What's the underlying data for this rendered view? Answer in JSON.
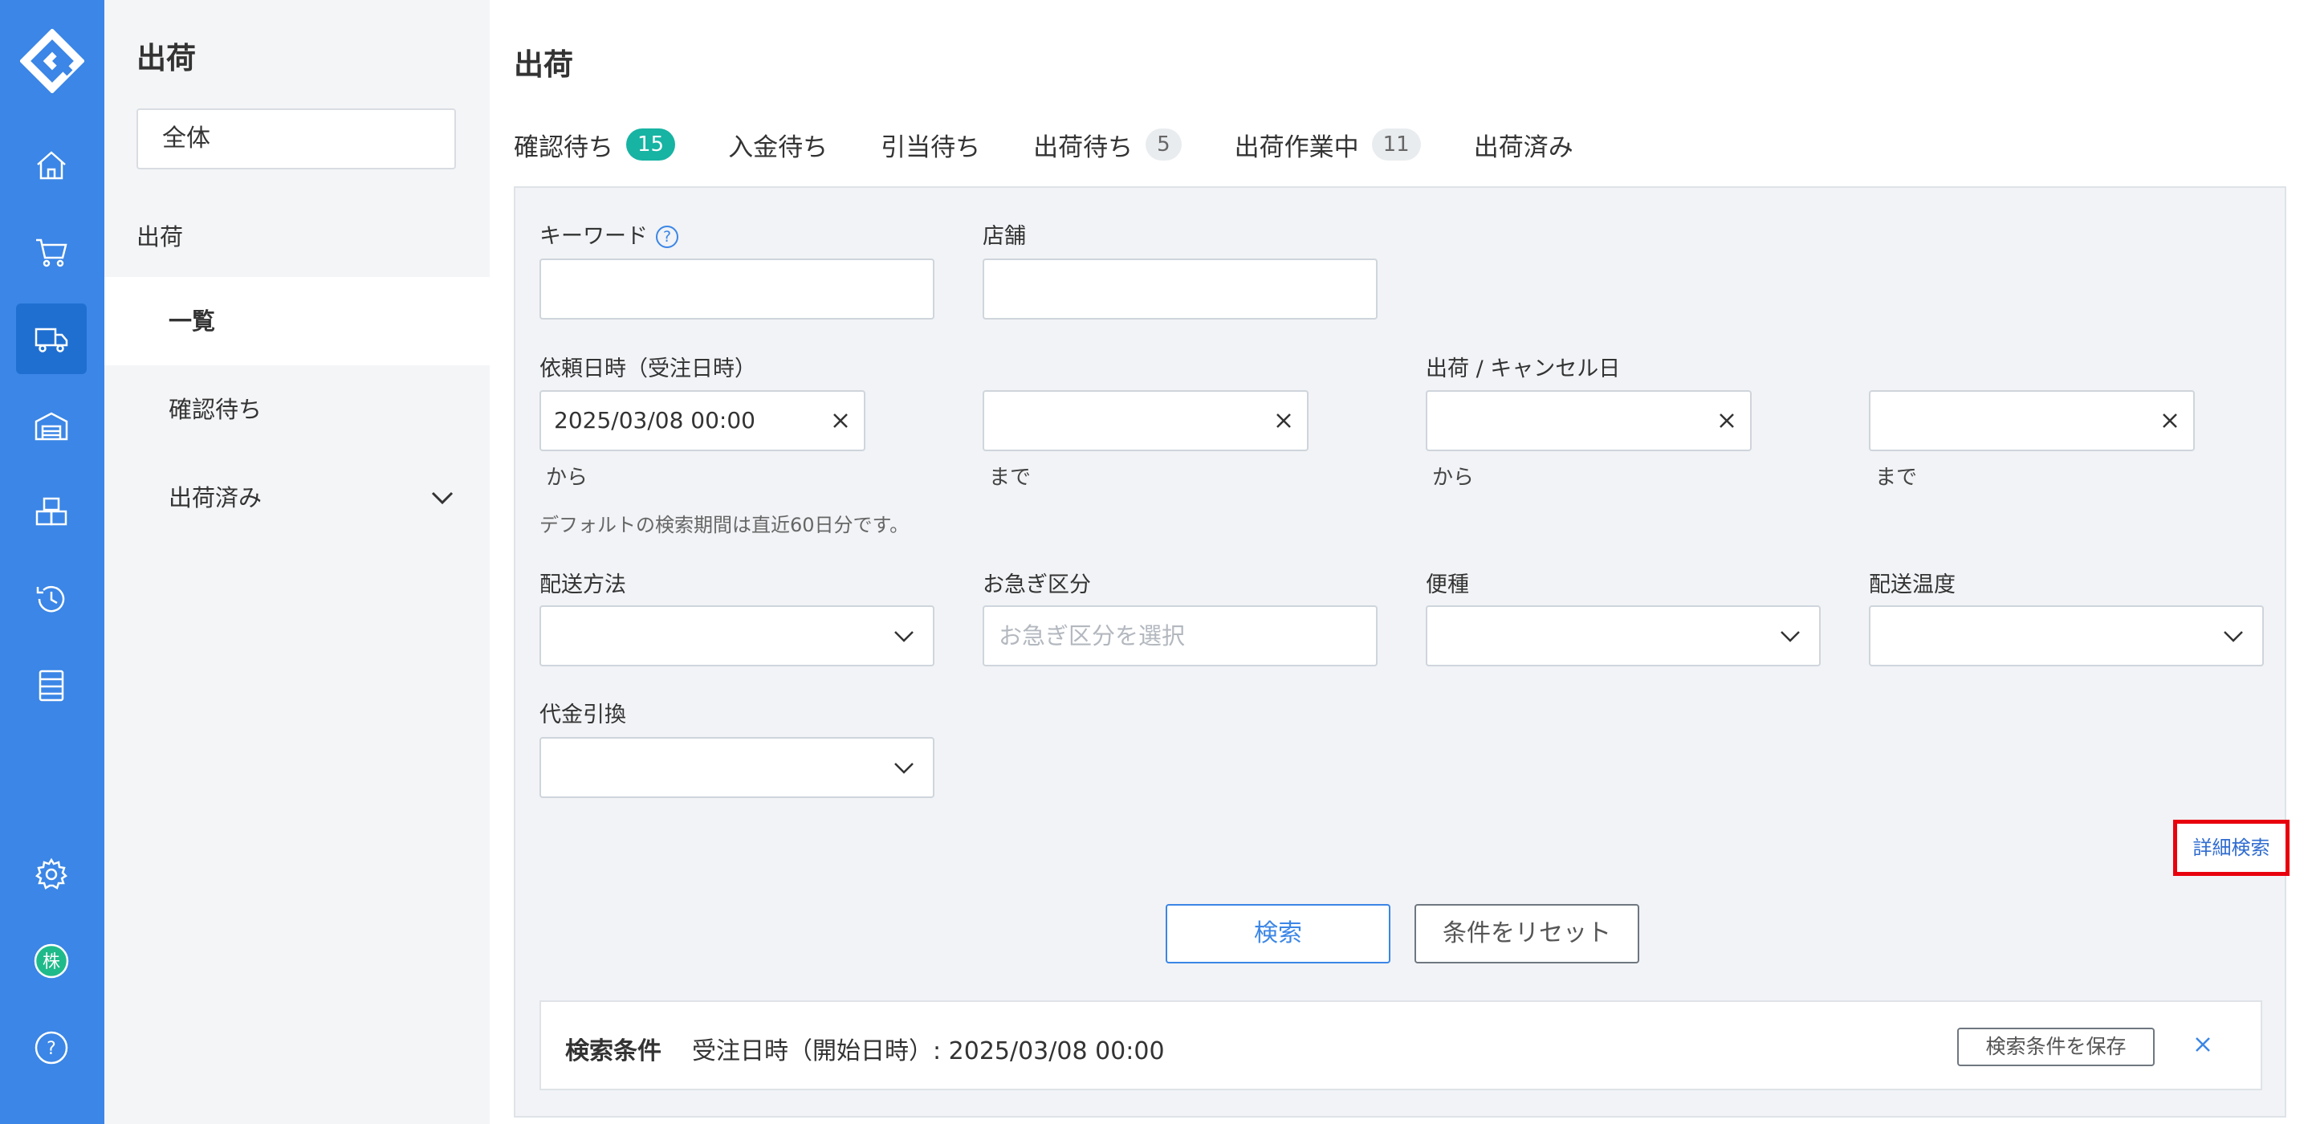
{
  "sidebar": {
    "title": "出荷",
    "scope": "全体",
    "section": "出荷",
    "items": [
      {
        "label": "一覧"
      },
      {
        "label": "確認待ち"
      },
      {
        "label": "出荷済み"
      }
    ]
  },
  "main": {
    "title": "出荷",
    "tabs": [
      {
        "label": "確認待ち",
        "badge": "15"
      },
      {
        "label": "入金待ち",
        "badge": ""
      },
      {
        "label": "引当待ち",
        "badge": ""
      },
      {
        "label": "出荷待ち",
        "badge": "5"
      },
      {
        "label": "出荷作業中",
        "badge": "11"
      },
      {
        "label": "出荷済み",
        "badge": ""
      }
    ]
  },
  "form": {
    "keyword_label": "キーワード",
    "store_label": "店舗",
    "request_date_label": "依頼日時（受注日時）",
    "request_from_value": "2025/03/08 00:00",
    "request_to_value": "",
    "ship_date_label": "出荷 / キャンセル日",
    "from_label": "から",
    "to_label": "まで",
    "default_note": "デフォルトの検索期間は直近60日分です。",
    "delivery_method_label": "配送方法",
    "urgency_label": "お急ぎ区分",
    "urgency_placeholder": "お急ぎ区分を選択",
    "flight_label": "便種",
    "temperature_label": "配送温度",
    "cod_label": "代金引換",
    "advanced_search": "詳細検索",
    "search_button": "検索",
    "reset_button": "条件をリセット"
  },
  "conditions": {
    "heading": "検索条件",
    "text": "受注日時（開始日時）: 2025/03/08 00:00",
    "save_button": "検索条件を保存"
  },
  "colors": {
    "rail": "#3b86e6",
    "accent": "#3b86e6",
    "badge_green": "#17b3a3",
    "highlight": "#e8000d"
  }
}
